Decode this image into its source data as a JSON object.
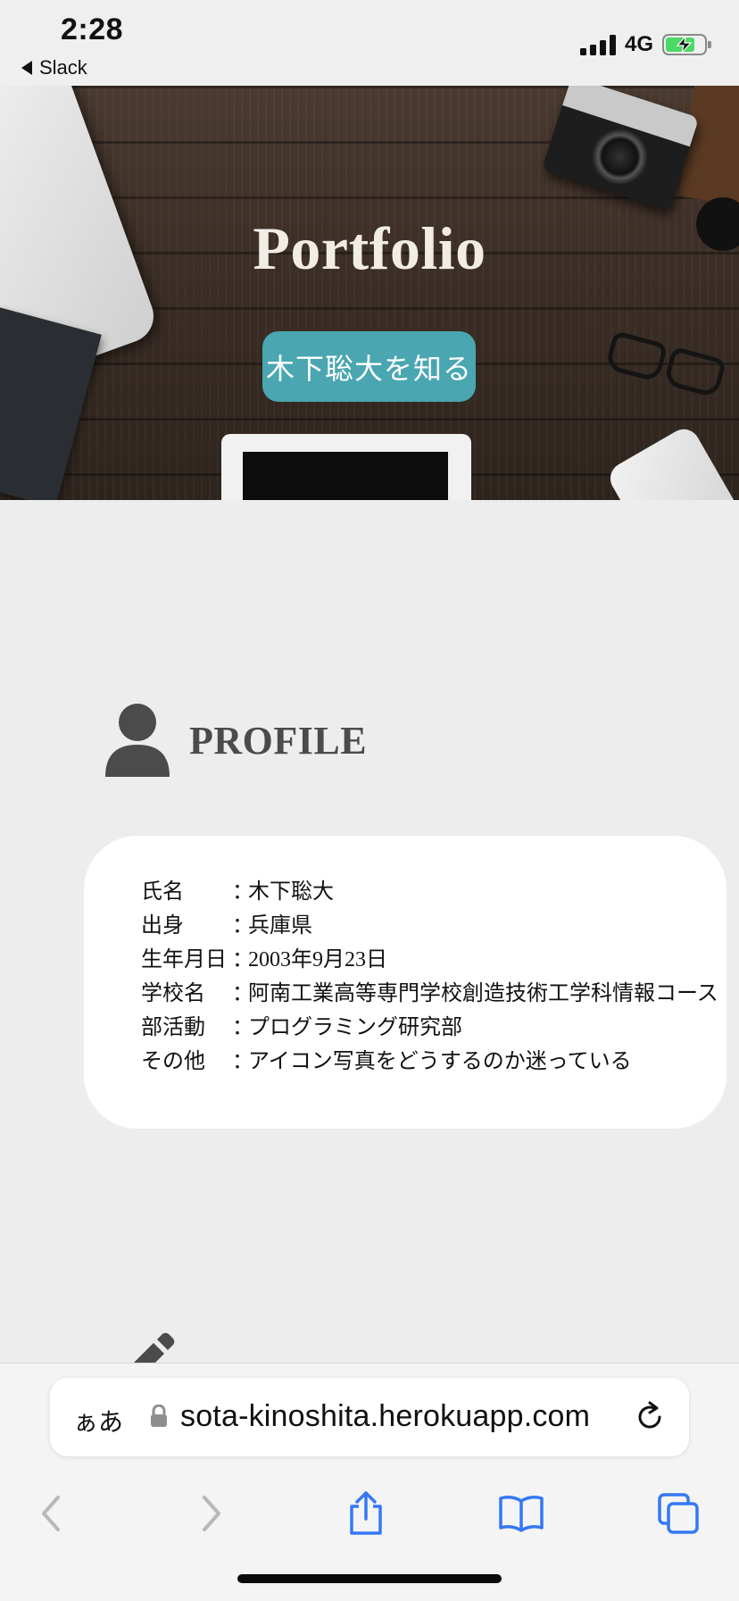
{
  "status_bar": {
    "time": "2:28",
    "back_app": "Slack",
    "network": "4G"
  },
  "hero": {
    "title": "Portfolio",
    "button_label": "木下聡大を知る"
  },
  "profile": {
    "title": "PROFILE",
    "rows": [
      {
        "label": "氏名",
        "sep": "：",
        "value": "木下聡大"
      },
      {
        "label": "出身",
        "sep": "：",
        "value": "兵庫県"
      },
      {
        "label": "生年月日",
        "sep": "：",
        "value": "2003年9月23日"
      },
      {
        "label": "学校名",
        "sep": "：",
        "value": "阿南工業高等専門学校創造技術工学科情報コース"
      },
      {
        "label": "部活動",
        "sep": "：",
        "value": "プログラミング研究部"
      },
      {
        "label": "その他",
        "sep": "：",
        "value": "アイコン写真をどうするのか迷っている"
      }
    ]
  },
  "browser": {
    "text_size_label": "ぁあ",
    "url": "sota-kinoshita.herokuapp.com"
  },
  "colors": {
    "accent": "#4aa6b0",
    "page_background": "#ededed",
    "ios_blue": "#3478f6"
  }
}
